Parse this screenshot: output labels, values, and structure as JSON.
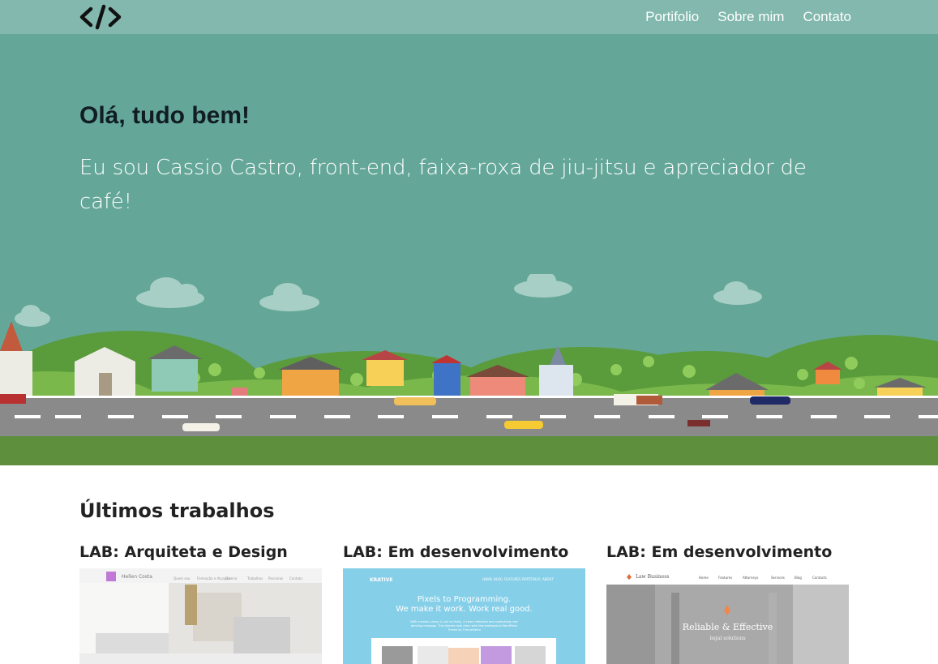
{
  "nav": {
    "logo_icon": "code-brackets-icon",
    "links": [
      "Portifolio",
      "Sobre mim",
      "Contato"
    ]
  },
  "hero": {
    "greeting": "Olá, tudo bem!",
    "intro": "Eu sou Cassio Castro, front-end, faixa-roxa de jiu-jitsu e apreciador de café!"
  },
  "works": {
    "title": "Últimos trabalhos",
    "cards": [
      {
        "title": "LAB: Arquiteta e Design",
        "thumb": {
          "brand": "Hellen Costa",
          "menu": [
            "Quem sou",
            "Formação e Atuação",
            "Galeria",
            "Trabalhos",
            "Parceiros",
            "Contato"
          ]
        }
      },
      {
        "title": "LAB: Em desenvolvimento",
        "thumb": {
          "brand": "KRATIVE",
          "menu": [
            "HOME",
            "BLOG",
            "FEATURES",
            "PORTFOLIO",
            "ABOUT"
          ],
          "headline1": "Pixels to Programming.",
          "headline2": "We make it work. Work real good.",
          "subtext": "With a smart, classy & just so finely, A clean reflection and captivating new pending message. This themes look clean with few professional WordPress Theme by ThemeMetro"
        }
      },
      {
        "title": "LAB: Em desenvolvimento",
        "thumb": {
          "brand": "Law Business",
          "menu": [
            "Home",
            "Features",
            "Attorneys",
            "Services",
            "Blog",
            "Contacts"
          ],
          "headline": "Reliable & Effective",
          "subline": "legal solutions"
        }
      }
    ]
  },
  "colors": {
    "navbar": "#82b8ad",
    "hero": "#64a798",
    "grass": "#5d8f3d",
    "road": "#8a8a8a"
  }
}
